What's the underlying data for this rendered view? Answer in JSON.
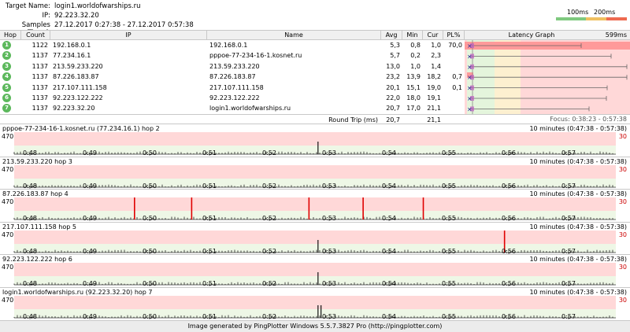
{
  "header": {
    "target_label": "Target Name:",
    "target_value": "login1.worldofwarships.ru",
    "ip_label": "IP:",
    "ip_value": "92.223.32.20",
    "samples_label": "Samples Timed:",
    "samples_value": "27.12.2017 0:27:38 - 27.12.2017 0:57:38",
    "legend_100": "100ms",
    "legend_200": "200ms",
    "legend_colors": [
      "#7fc97f",
      "#f0c060",
      "#ee6a50"
    ]
  },
  "table": {
    "columns": [
      "Hop",
      "Count",
      "IP",
      "Name",
      "Avg",
      "Min",
      "Cur",
      "PL%",
      "Latency Graph"
    ],
    "latency_max": "599ms",
    "rows": [
      {
        "hop": "1",
        "count": "1122",
        "ip": "192.168.0.1",
        "name": "192.168.0.1",
        "avg": "5,3",
        "min": "0,8",
        "cur": "1,0",
        "pl": "70,0"
      },
      {
        "hop": "2",
        "count": "1137",
        "ip": "77.234.16.1",
        "name": "pppoe-77-234-16-1.kosnet.ru",
        "avg": "5,7",
        "min": "0,2",
        "cur": "2,3",
        "pl": ""
      },
      {
        "hop": "3",
        "count": "1137",
        "ip": "213.59.233.220",
        "name": "213.59.233.220",
        "avg": "13,0",
        "min": "1,0",
        "cur": "1,4",
        "pl": ""
      },
      {
        "hop": "4",
        "count": "1137",
        "ip": "87.226.183.87",
        "name": "87.226.183.87",
        "avg": "23,2",
        "min": "13,9",
        "cur": "18,2",
        "pl": "0,7"
      },
      {
        "hop": "5",
        "count": "1137",
        "ip": "217.107.111.158",
        "name": "217.107.111.158",
        "avg": "20,1",
        "min": "15,1",
        "cur": "19,0",
        "pl": "0,1"
      },
      {
        "hop": "6",
        "count": "1137",
        "ip": "92.223.122.222",
        "name": "92.223.122.222",
        "avg": "22,0",
        "min": "18,0",
        "cur": "19,1",
        "pl": ""
      },
      {
        "hop": "7",
        "count": "1137",
        "ip": "92.223.32.20",
        "name": "login1.worldofwarships.ru",
        "avg": "20,7",
        "min": "17,0",
        "cur": "21,1",
        "pl": ""
      }
    ],
    "round_trip_label": "Round Trip (ms)",
    "round_trip_avg": "20,7",
    "round_trip_cur": "21,1",
    "focus": "Focus: 0:38:23 - 0:57:38",
    "colors": {
      "hop_green": "#5cb85c",
      "pl_red": "#ff9a9a",
      "zone_green": "#e4f5dc",
      "zone_yellow": "#fdf0d0"
    }
  },
  "timelines": [
    {
      "title": "pppoe-77-234-16-1.kosnet.ru (77.234.16.1) hop 2",
      "range": "10 minutes (0:47:38 - 0:57:38)",
      "ymax": "470",
      "pl_max": "30",
      "spikes": [
        0.505
      ],
      "loss_marks": []
    },
    {
      "title": "213.59.233.220 hop 3",
      "range": "10 minutes (0:47:38 - 0:57:38)",
      "ymax": "470",
      "pl_max": "30",
      "spikes": [],
      "loss_marks": []
    },
    {
      "title": "87.226.183.87 hop 4",
      "range": "10 minutes (0:47:38 - 0:57:38)",
      "ymax": "470",
      "pl_max": "30",
      "spikes": [],
      "loss_marks": [
        0.2,
        0.295,
        0.49,
        0.58,
        0.68
      ]
    },
    {
      "title": "217.107.111.158 hop 5",
      "range": "10 minutes (0:47:38 - 0:57:38)",
      "ymax": "470",
      "pl_max": "30",
      "spikes": [
        0.505
      ],
      "loss_marks": [
        0.815
      ]
    },
    {
      "title": "92.223.122.222 hop 6",
      "range": "10 minutes (0:47:38 - 0:57:38)",
      "ymax": "470",
      "pl_max": "30",
      "spikes": [
        0.505
      ],
      "loss_marks": []
    },
    {
      "title": "login1.worldofwarships.ru (92.223.32.20) hop 7",
      "range": "10 minutes (0:47:38 - 0:57:38)",
      "ymax": "470",
      "pl_max": "30",
      "spikes": [
        0.505,
        0.51
      ],
      "loss_marks": []
    }
  ],
  "time_ticks": [
    "0:48",
    "0:49",
    "0:50",
    "0:51",
    "0:52",
    "0:53",
    "0:54",
    "0:55",
    "0:56",
    "0:57"
  ],
  "footer": "Image generated by PingPlotter Windows 5.5.7.3827 Pro (http://pingplotter.com)"
}
